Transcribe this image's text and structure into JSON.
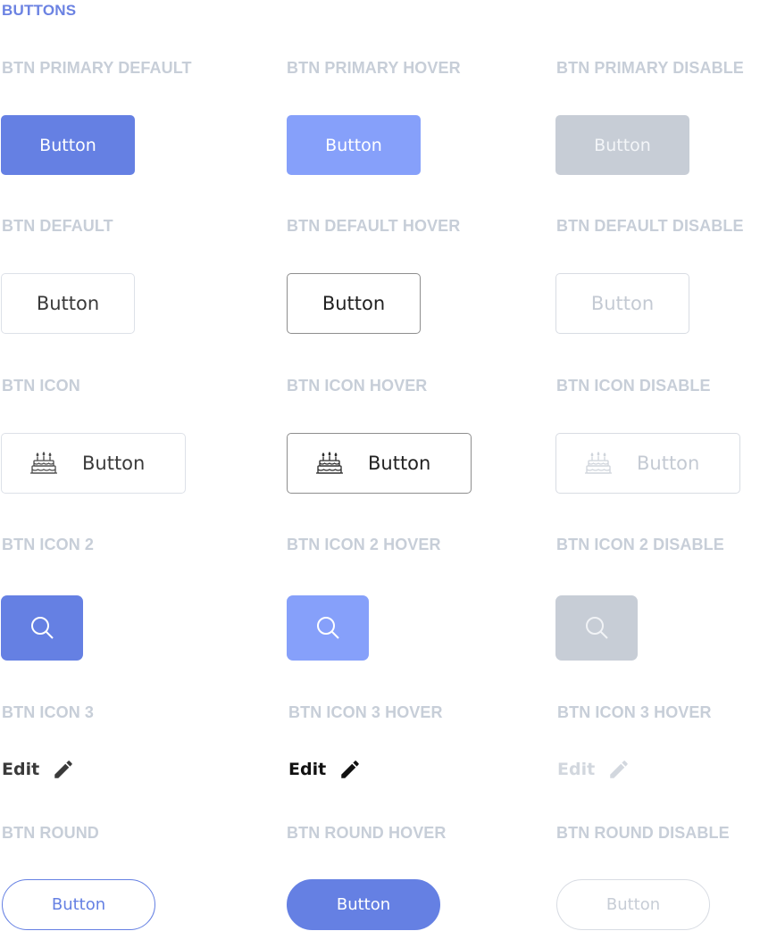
{
  "section_title": "BUTTONS",
  "colors": {
    "primary": "#6580e3",
    "primary_hover": "#86a0fa",
    "disabled": "#c7cdd6",
    "label": "#c7ced8",
    "border": "#dde1e8"
  },
  "rows": {
    "primary": {
      "labels": [
        "BTN PRIMARY DEFAULT",
        "BTN PRIMARY HOVER",
        "BTN PRIMARY DISABLE"
      ],
      "button_label": "Button"
    },
    "default": {
      "labels": [
        "BTN DEFAULT",
        "BTN DEFAULT HOVER",
        "BTN DEFAULT DISABLE"
      ],
      "button_label": "Button"
    },
    "icon": {
      "labels": [
        "BTN ICON",
        "BTN ICON HOVER",
        "BTN ICON DISABLE"
      ],
      "button_label": "Button",
      "icon": "cake-icon"
    },
    "icon2": {
      "labels": [
        "BTN ICON 2",
        "BTN ICON 2 HOVER",
        "BTN ICON 2 DISABLE"
      ],
      "icon": "search-icon"
    },
    "icon3": {
      "labels": [
        "BTN ICON 3",
        "BTN ICON 3 HOVER",
        "BTN ICON 3 HOVER"
      ],
      "button_label": "Edit",
      "icon": "pencil-icon"
    },
    "round": {
      "labels": [
        "BTN ROUND",
        "BTN ROUND HOVER",
        "BTN ROUND DISABLE"
      ],
      "button_label": "Button"
    }
  }
}
